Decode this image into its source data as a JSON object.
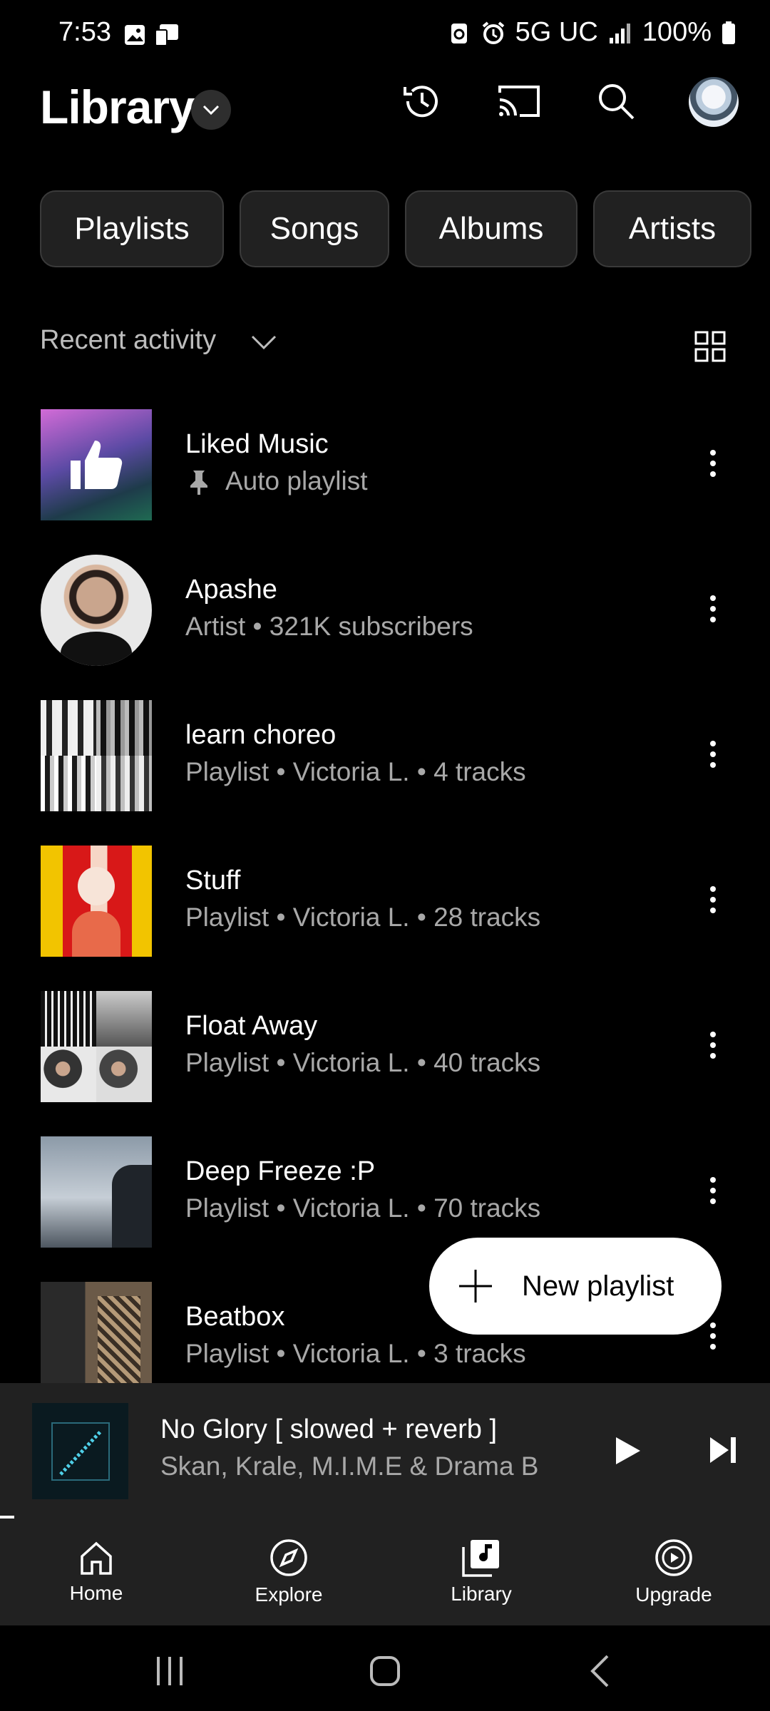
{
  "status_bar": {
    "time": "7:53",
    "network": "5G UC",
    "battery": "100%"
  },
  "header": {
    "title": "Library"
  },
  "chips": [
    "Playlists",
    "Songs",
    "Albums",
    "Artists"
  ],
  "sort": {
    "label": "Recent activity"
  },
  "items": [
    {
      "title": "Liked Music",
      "subtitle": "Auto playlist",
      "pinned": true
    },
    {
      "title": "Apashe",
      "subtitle": "Artist • 321K subscribers"
    },
    {
      "title": "learn choreo",
      "subtitle": "Playlist • Victoria L. • 4 tracks"
    },
    {
      "title": "Stuff",
      "subtitle": "Playlist • Victoria L. • 28 tracks"
    },
    {
      "title": "Float Away",
      "subtitle": "Playlist • Victoria L. • 40 tracks"
    },
    {
      "title": "Deep Freeze :P",
      "subtitle": "Playlist • Victoria L. • 70 tracks"
    },
    {
      "title": "Beatbox",
      "subtitle": "Playlist • Victoria L. • 3 tracks"
    }
  ],
  "fab": {
    "label": "New playlist"
  },
  "now_playing": {
    "title": "No Glory [ slowed + reverb ]",
    "artist": "Skan, Krale, M.I.M.E & Drama B"
  },
  "nav": {
    "home": "Home",
    "explore": "Explore",
    "library": "Library",
    "upgrade": "Upgrade"
  },
  "icons": {
    "history": "history-icon",
    "cast": "cast-icon",
    "search": "search-icon",
    "more": "more-vert-icon",
    "play": "play-icon",
    "next": "skip-next-icon",
    "grid": "grid-view-icon"
  }
}
